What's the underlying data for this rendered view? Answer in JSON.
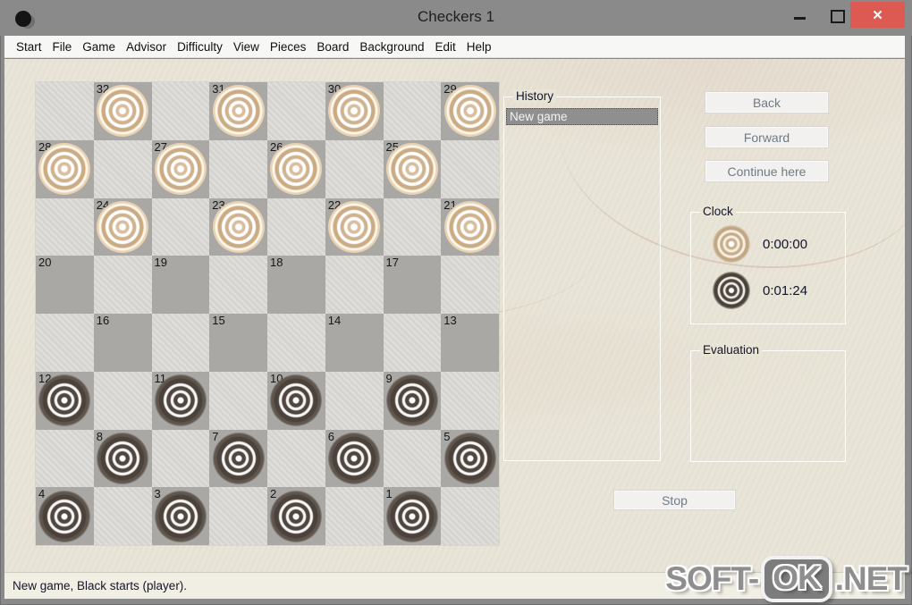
{
  "window": {
    "title": "Checkers 1",
    "controls": {
      "close_glyph": "✕"
    }
  },
  "menu": {
    "items": [
      "Start",
      "File",
      "Game",
      "Advisor",
      "Difficulty",
      "View",
      "Pieces",
      "Board",
      "Background",
      "Edit",
      "Help"
    ]
  },
  "board": {
    "squares": [
      {
        "num": 32,
        "row": 0,
        "col": 1,
        "piece": "white"
      },
      {
        "num": 31,
        "row": 0,
        "col": 3,
        "piece": "white"
      },
      {
        "num": 30,
        "row": 0,
        "col": 5,
        "piece": "white"
      },
      {
        "num": 29,
        "row": 0,
        "col": 7,
        "piece": "white"
      },
      {
        "num": 28,
        "row": 1,
        "col": 0,
        "piece": "white"
      },
      {
        "num": 27,
        "row": 1,
        "col": 2,
        "piece": "white"
      },
      {
        "num": 26,
        "row": 1,
        "col": 4,
        "piece": "white"
      },
      {
        "num": 25,
        "row": 1,
        "col": 6,
        "piece": "white"
      },
      {
        "num": 24,
        "row": 2,
        "col": 1,
        "piece": "white"
      },
      {
        "num": 23,
        "row": 2,
        "col": 3,
        "piece": "white"
      },
      {
        "num": 22,
        "row": 2,
        "col": 5,
        "piece": "white"
      },
      {
        "num": 21,
        "row": 2,
        "col": 7,
        "piece": "white"
      },
      {
        "num": 20,
        "row": 3,
        "col": 0,
        "piece": null
      },
      {
        "num": 19,
        "row": 3,
        "col": 2,
        "piece": null
      },
      {
        "num": 18,
        "row": 3,
        "col": 4,
        "piece": null
      },
      {
        "num": 17,
        "row": 3,
        "col": 6,
        "piece": null
      },
      {
        "num": 16,
        "row": 4,
        "col": 1,
        "piece": null
      },
      {
        "num": 15,
        "row": 4,
        "col": 3,
        "piece": null
      },
      {
        "num": 14,
        "row": 4,
        "col": 5,
        "piece": null
      },
      {
        "num": 13,
        "row": 4,
        "col": 7,
        "piece": null
      },
      {
        "num": 12,
        "row": 5,
        "col": 0,
        "piece": "black"
      },
      {
        "num": 11,
        "row": 5,
        "col": 2,
        "piece": "black"
      },
      {
        "num": 10,
        "row": 5,
        "col": 4,
        "piece": "black"
      },
      {
        "num": 9,
        "row": 5,
        "col": 6,
        "piece": "black"
      },
      {
        "num": 8,
        "row": 6,
        "col": 1,
        "piece": "black"
      },
      {
        "num": 7,
        "row": 6,
        "col": 3,
        "piece": "black"
      },
      {
        "num": 6,
        "row": 6,
        "col": 5,
        "piece": "black"
      },
      {
        "num": 5,
        "row": 6,
        "col": 7,
        "piece": "black"
      },
      {
        "num": 4,
        "row": 7,
        "col": 0,
        "piece": "black"
      },
      {
        "num": 3,
        "row": 7,
        "col": 2,
        "piece": "black"
      },
      {
        "num": 2,
        "row": 7,
        "col": 4,
        "piece": "black"
      },
      {
        "num": 1,
        "row": 7,
        "col": 6,
        "piece": "black"
      }
    ]
  },
  "history": {
    "label": "History",
    "items": [
      {
        "text": "New game",
        "selected": true
      }
    ]
  },
  "nav_buttons": {
    "back": "Back",
    "forward": "Forward",
    "continue_here": "Continue here"
  },
  "clock": {
    "label": "Clock",
    "white_time": "0:00:00",
    "black_time": "0:01:24"
  },
  "evaluation": {
    "label": "Evaluation"
  },
  "stop_button": {
    "label": "Stop"
  },
  "status_bar": {
    "text": "New game, Black starts (player)."
  },
  "watermark": {
    "prefix": "SOFT-",
    "boxed": "OK",
    "suffix": ".NET"
  },
  "colors": {
    "titlebar": "#8a8a8a",
    "close_button": "#dc5a52",
    "menu_bg": "#f7f7f6",
    "client_bg": "#e8e4d6",
    "board_dark": "#a9a8a5",
    "board_light": "#d8d7d3",
    "white_piece": "#cbab84",
    "black_piece": "#4a423b",
    "selection_bg": "#8f8f8f",
    "status_bg": "#f1eee3"
  }
}
